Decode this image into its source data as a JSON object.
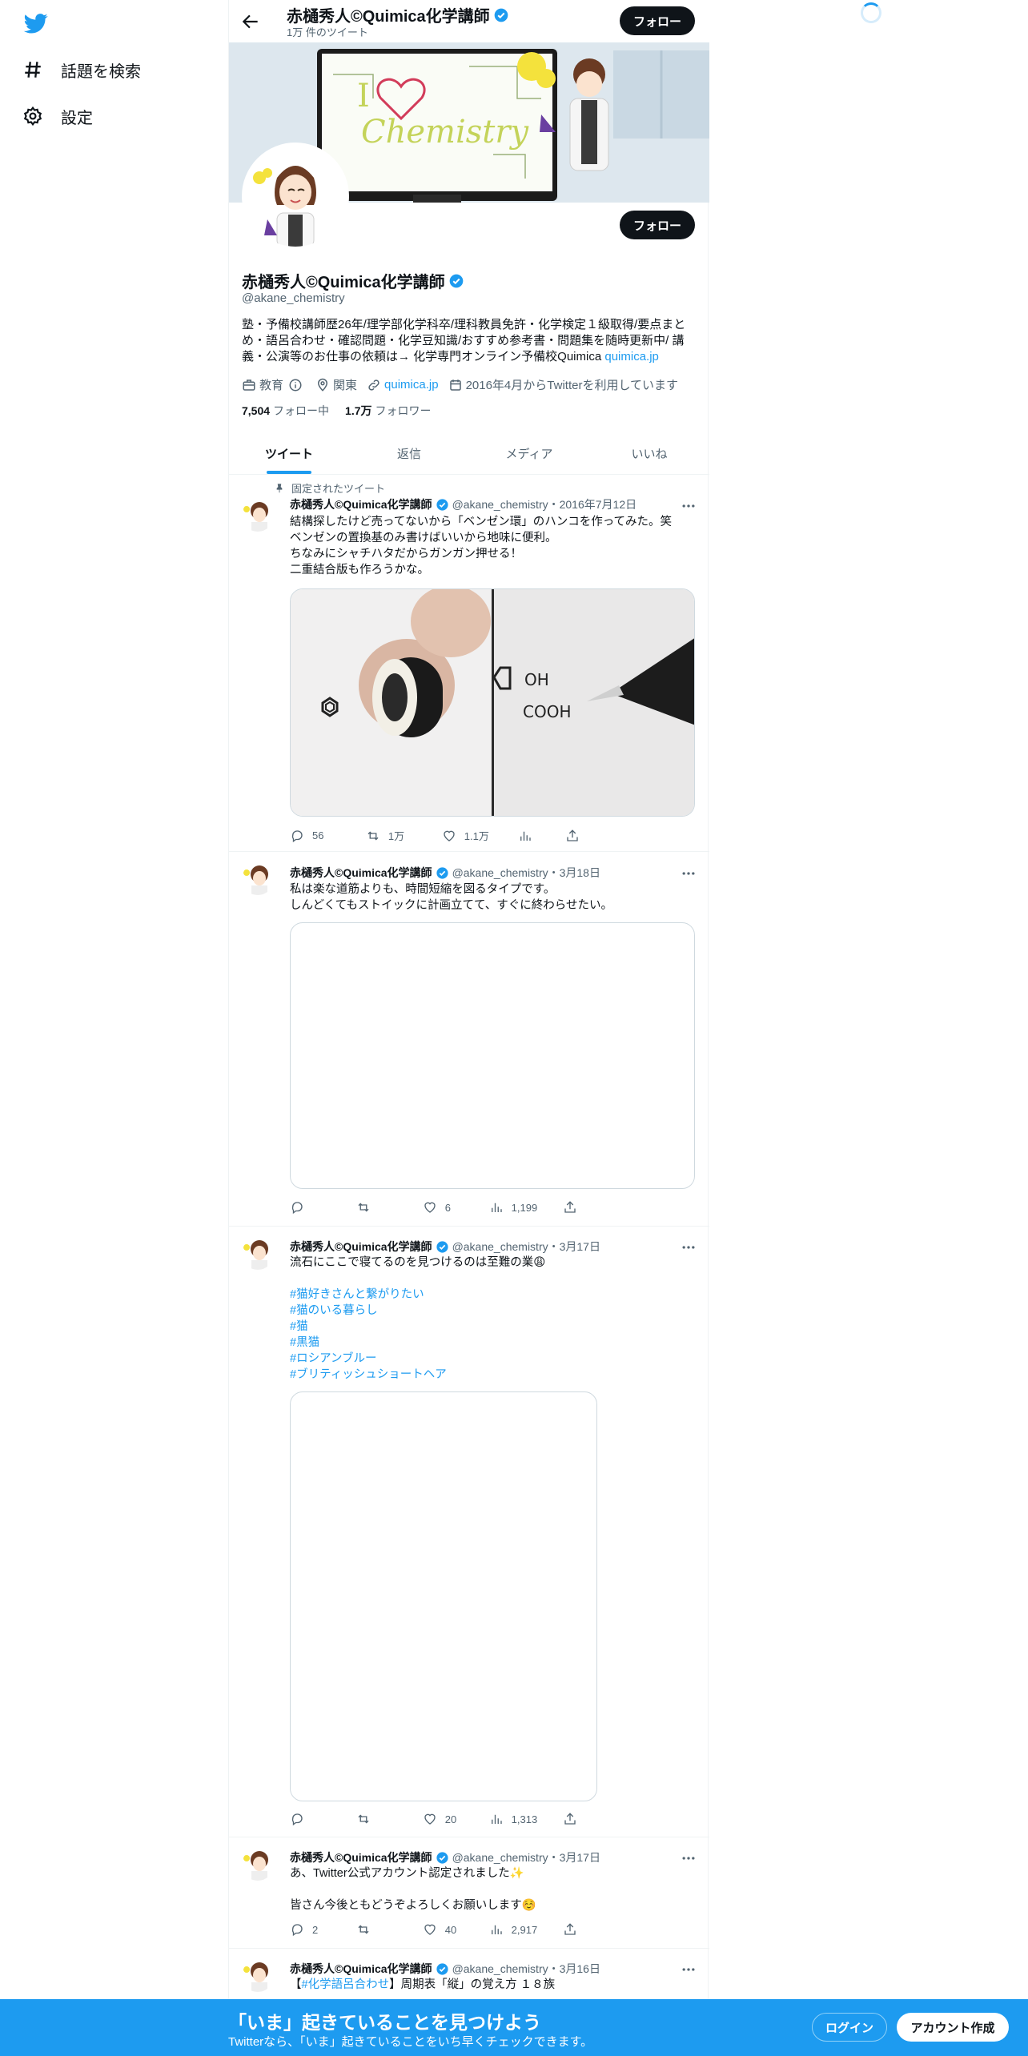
{
  "nav": {
    "logo": "twitter-bird-icon",
    "items": [
      {
        "label": "話題を検索",
        "icon": "hashtag-icon"
      },
      {
        "label": "設定",
        "icon": "gear-icon"
      }
    ]
  },
  "header": {
    "name": "赤樋秀人©Quimica化学講師",
    "tweet_count": "1万 件のツイート",
    "follow_label": "フォロー"
  },
  "banner": {
    "text": "I ♡ Chemistry"
  },
  "profile": {
    "name": "赤樋秀人©Quimica化学講師",
    "handle": "@akane_chemistry",
    "bio": "塾・予備校講師歴26年/理学部化学科卒/理科教員免許・化学検定１級取得/要点まとめ・語呂合わせ・確認問題・化学豆知識/おすすめ参考書・問題集を随時更新中/ 講義・公演等のお仕事の依頼は→ 化学専門オンライン予備校Quimica ",
    "bio_link": "quimica.jp",
    "category": "教育",
    "location": "関東",
    "website": "quimica.jp",
    "joined": "2016年4月からTwitterを利用しています",
    "following_count": "7,504",
    "following_label": "フォロー中",
    "followers_count": "1.7万",
    "followers_label": "フォロワー",
    "follow_label": "フォロー"
  },
  "tabs": [
    "ツイート",
    "返信",
    "メディア",
    "いいね"
  ],
  "pinned_label": "固定されたツイート",
  "tweets": [
    {
      "name": "赤樋秀人©Quimica化学講師",
      "handle": "@akane_chemistry",
      "date": "・2016年7月12日",
      "lines": [
        "結構探したけど売ってないから「ベンゼン環」のハンコを作ってみた。笑",
        "ベンゼンの置換基のみ書けばいいから地味に便利。",
        "ちなみにシャチハタだからガンガン押せる！",
        "二重結合版も作ろうかな。"
      ],
      "media_text": [
        "OH",
        "COOH"
      ],
      "reply": "56",
      "retweet": "1万",
      "like": "1.1万",
      "views": ""
    },
    {
      "name": "赤樋秀人©Quimica化学講師",
      "handle": "@akane_chemistry",
      "date": "・3月18日",
      "lines": [
        "私は楽な道筋よりも、時間短縮を図るタイプです。",
        "しんどくてもストイックに計画立てて、すぐに終わらせたい。"
      ],
      "reply": "",
      "retweet": "",
      "like": "6",
      "views": "1,199"
    },
    {
      "name": "赤樋秀人©Quimica化学講師",
      "handle": "@akane_chemistry",
      "date": "・3月17日",
      "lines": [
        "流石にここで寝てるのを見つけるのは至難の業😩"
      ],
      "hashtags": [
        "#猫好きさんと繋がりたい",
        "#猫のいる暮らし",
        "#猫",
        "#黒猫",
        "#ロシアンブルー",
        "#ブリティッシュショートヘア"
      ],
      "reply": "",
      "retweet": "",
      "like": "20",
      "views": "1,313"
    },
    {
      "name": "赤樋秀人©Quimica化学講師",
      "handle": "@akane_chemistry",
      "date": "・3月17日",
      "lines": [
        "あ、Twitter公式アカウント認定されました✨",
        "",
        "皆さん今後ともどうぞよろしくお願いします☺️"
      ],
      "reply": "2",
      "retweet": "",
      "like": "40",
      "views": "2,917"
    },
    {
      "name": "赤樋秀人©Quimica化学講師",
      "handle": "@akane_chemistry",
      "date": "・3月16日",
      "line_prefix": "【",
      "line_tag": "#化学語呂合わせ",
      "line_rest": "】周期表「縦」の覚え方 １８族"
    }
  ],
  "bottom": {
    "title": "「いま」起きていることを見つけよう",
    "subtitle": "Twitterなら、「いま」起きていることをいち早くチェックできます。",
    "login": "ログイン",
    "signup": "アカウント作成"
  },
  "colors": {
    "accent": "#1d9bf0",
    "text": "#0f1419",
    "muted": "#536471"
  }
}
